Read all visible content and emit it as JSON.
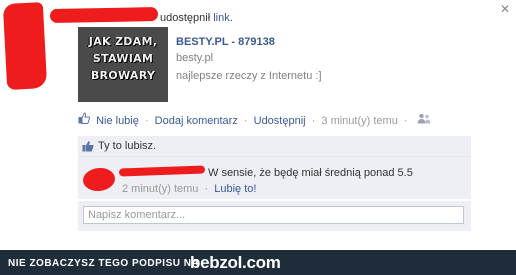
{
  "post": {
    "header_action": "udostępnił",
    "header_link": "link",
    "header_period": "."
  },
  "shared": {
    "image_text": "JAK ZDAM,\nSTAWIAM\nBROWARY",
    "title": "BESTY.PL - 879138",
    "domain": "besty.pl",
    "description": "najlepsze rzeczy z Internetu :]"
  },
  "actions": {
    "unlike": "Nie lubię",
    "comment": "Dodaj komentarz",
    "share": "Udostępnij",
    "time": "3 minut(y) temu",
    "sep": "·"
  },
  "likes": {
    "text": "Ty to lubisz."
  },
  "comment": {
    "text": "W sensie, że będę miał średnią ponad 5.5",
    "time": "2 minut(y) temu",
    "like": "Lubię to!",
    "sep": "·"
  },
  "reply": {
    "placeholder": "Napisz komentarz..."
  },
  "footer": {
    "text": "NIE ZOBACZYSZ TEGO PODPISU NA",
    "brand": "bebzol.com"
  },
  "colors": {
    "link": "#3b5998",
    "panel": "#edeff4",
    "footer_bg": "#1f2d3a",
    "redaction": "#ee1c1c"
  }
}
